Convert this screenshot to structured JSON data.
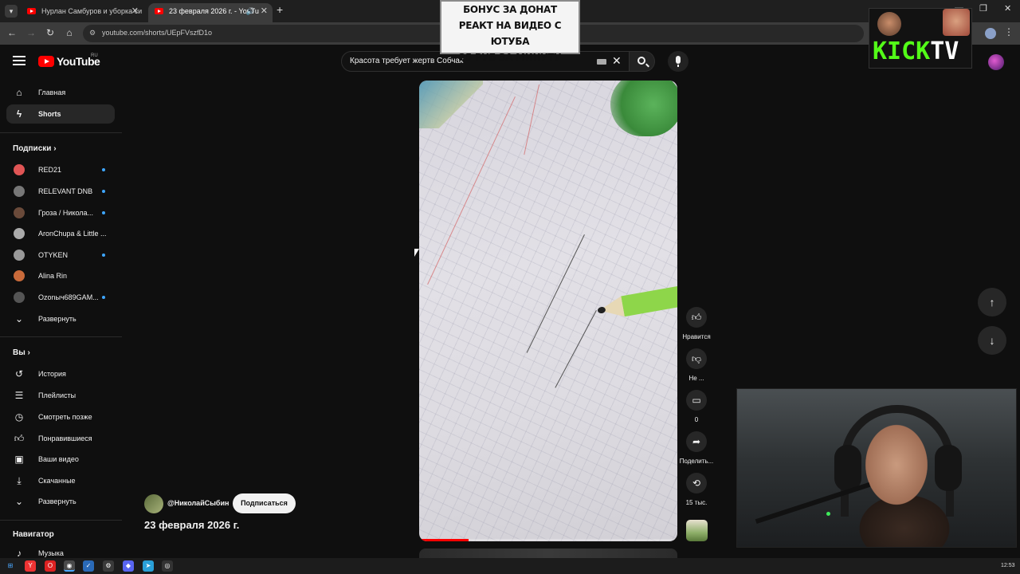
{
  "browser": {
    "tabs": [
      {
        "title": "Нурлан Самбуров и уборка си"
      },
      {
        "title": "23 февраля 2026 г. - YouTu"
      }
    ],
    "url": "youtube.com/shorts/UEpFVszfD1o"
  },
  "youtube": {
    "logo_text": "YouTube",
    "region": "RU",
    "search_query": "Красота требует жертв Собчак"
  },
  "sidebar": {
    "main": [
      {
        "label": "Главная",
        "icon": "home-icon"
      },
      {
        "label": "Shorts",
        "icon": "shorts-icon",
        "active": true
      }
    ],
    "subscriptions_title": "Подписки",
    "subscriptions": [
      {
        "label": "RED21",
        "color": "#e05555",
        "live": true
      },
      {
        "label": "RELEVANT DNB",
        "color": "#777777",
        "live": true
      },
      {
        "label": "Гроза / Никола...",
        "color": "#6a4a3a",
        "live": true
      },
      {
        "label": "AronChupa & Little ...",
        "color": "#aaaaaa",
        "live": false
      },
      {
        "label": "OTYKEN",
        "color": "#999999",
        "live": true
      },
      {
        "label": "Alina Rin",
        "color": "#c96a3a",
        "live": false
      },
      {
        "label": "Ozonыч689GAM...",
        "color": "#555555",
        "live": true
      }
    ],
    "subscriptions_expand": "Развернуть",
    "you_title": "Вы",
    "you_items": [
      {
        "label": "История",
        "icon": "history-icon"
      },
      {
        "label": "Плейлисты",
        "icon": "playlists-icon"
      },
      {
        "label": "Смотреть позже",
        "icon": "watch-later-icon"
      },
      {
        "label": "Понравившиеся",
        "icon": "liked-icon"
      },
      {
        "label": "Ваши видео",
        "icon": "your-videos-icon"
      },
      {
        "label": "Скачанные",
        "icon": "downloads-icon"
      }
    ],
    "you_expand": "Развернуть",
    "navigator_title": "Навигатор",
    "navigator_items": [
      {
        "label": "Музыка",
        "icon": "music-icon"
      }
    ]
  },
  "short": {
    "channel": "@НиколайСыбин",
    "subscribe_label": "Подписаться",
    "title": "23 февраля 2026 г.",
    "progress": 0.19
  },
  "actions": {
    "like_label": "Нравится",
    "dislike_label": "Не ...",
    "comments_count": "0",
    "share_label": "Поделить...",
    "remix_count": "15 тыс."
  },
  "overlay": {
    "donate_lines": [
      "БОНУС ЗА ДОНАТ",
      "РЕАКТ НА ВИДЕО С ЮТУБА",
      "25 РУБ ЗА МИНУТУ"
    ],
    "kick_logo": {
      "green": "KICK",
      "white": "TV"
    }
  },
  "taskbar": {
    "clock": "12:53"
  },
  "colors": {
    "accent": "#ff0000",
    "background": "#0f0f0f",
    "kick_green": "#53fc18"
  }
}
